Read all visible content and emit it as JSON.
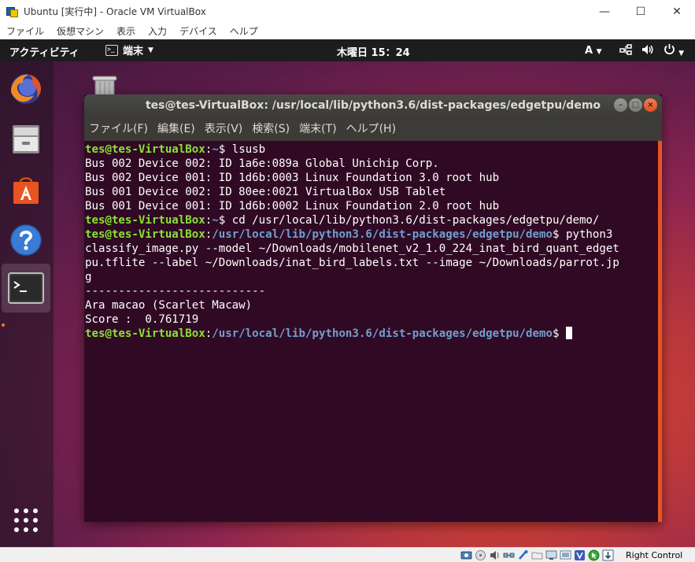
{
  "host": {
    "title": "Ubuntu [実行中] - Oracle VM VirtualBox",
    "controls": {
      "minimize": "—",
      "maximize": "☐",
      "close": "✕"
    },
    "menu": [
      "ファイル",
      "仮想マシン",
      "表示",
      "入力",
      "デバイス",
      "ヘルプ"
    ],
    "status_label": "Right Control",
    "status_icons": [
      "hard-disk-icon",
      "optical-drive-icon",
      "audio-icon",
      "network-icon",
      "usb-icon",
      "shared-folder-icon",
      "display-icon",
      "video-capture-icon",
      "vt-x-icon",
      "mouse-integration-icon",
      "keyboard-capture-icon"
    ]
  },
  "topbar": {
    "activities": "アクティビティ",
    "app_name": "端末",
    "clock": "木曜日 15：24",
    "input_method": "A"
  },
  "dock": {
    "items": [
      "firefox-icon",
      "files-icon",
      "software-center-icon",
      "help-icon",
      "terminal-icon"
    ]
  },
  "terminal": {
    "title": "tes@tes-VirtualBox: /usr/local/lib/python3.6/dist-packages/edgetpu/demo",
    "menu": [
      "ファイル(F)",
      "編集(E)",
      "表示(V)",
      "検索(S)",
      "端末(T)",
      "ヘルプ(H)"
    ],
    "prompt_user": "tes@tes-VirtualBox",
    "prompt_sep": ":",
    "home_path": "~",
    "demo_path": "/usr/local/lib/python3.6/dist-packages/edgetpu/demo",
    "prompt_suffix": "$ ",
    "cmd1": "lsusb",
    "usb_lines": [
      "Bus 002 Device 002: ID 1a6e:089a Global Unichip Corp.",
      "Bus 002 Device 001: ID 1d6b:0003 Linux Foundation 3.0 root hub",
      "Bus 001 Device 002: ID 80ee:0021 VirtualBox USB Tablet",
      "Bus 001 Device 001: ID 1d6b:0002 Linux Foundation 2.0 root hub"
    ],
    "cmd2": "cd /usr/local/lib/python3.6/dist-packages/edgetpu/demo/",
    "cmd3_start": "python3",
    "cmd3_wrapped": [
      "classify_image.py --model ~/Downloads/mobilenet_v2_1.0_224_inat_bird_quant_edget",
      "pu.tflite --label ~/Downloads/inat_bird_labels.txt --image ~/Downloads/parrot.jp",
      "g"
    ],
    "output": [
      "---------------------------",
      "Ara macao (Scarlet Macaw)",
      "Score :  0.761719"
    ]
  }
}
